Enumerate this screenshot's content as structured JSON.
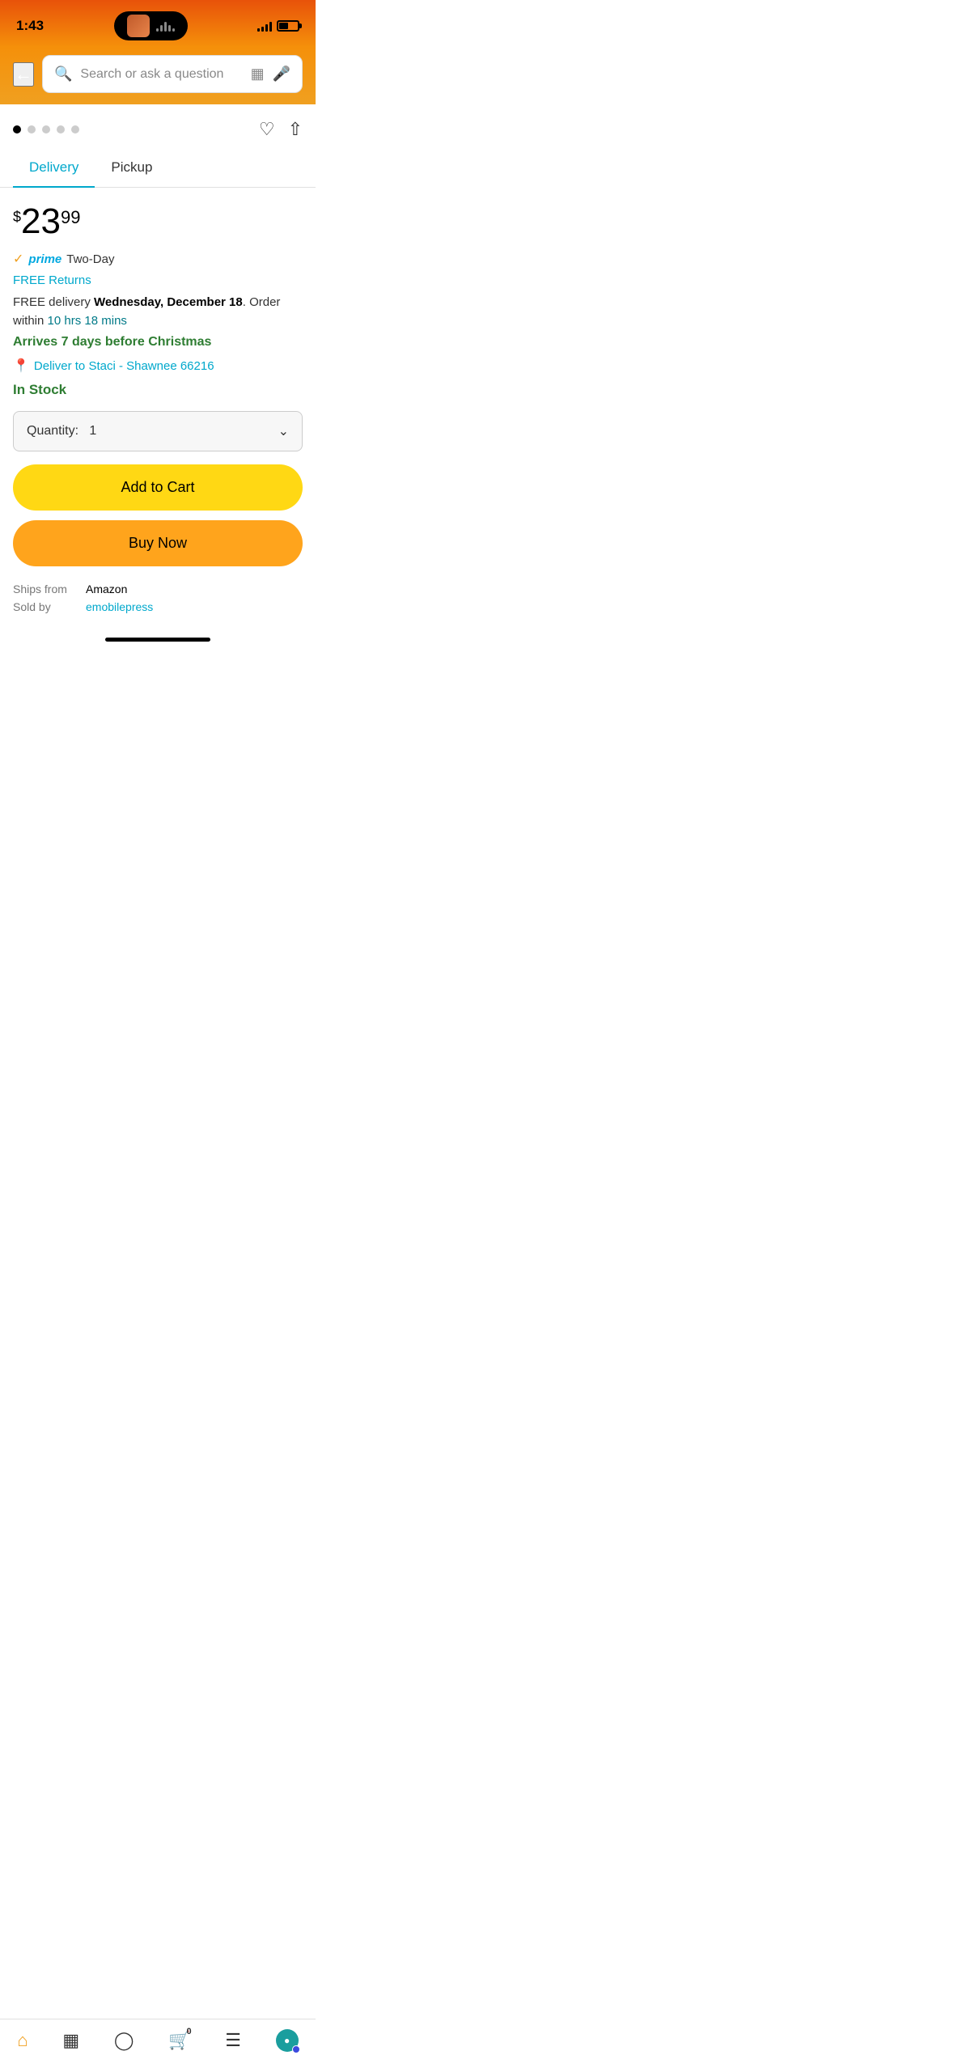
{
  "status": {
    "time": "1:43",
    "battery_pct": 50
  },
  "header": {
    "search_placeholder": "Search or ask a question"
  },
  "carousel": {
    "total_dots": 5,
    "active_dot": 0
  },
  "tabs": {
    "delivery_label": "Delivery",
    "pickup_label": "Pickup",
    "active": "delivery"
  },
  "product": {
    "price_dollar": "$",
    "price_main": "23",
    "price_cents": "99",
    "prime_label": "prime",
    "prime_delivery": "Two-Day",
    "free_returns": "FREE Returns",
    "delivery_text_before": "FREE delivery ",
    "delivery_date": "Wednesday, December 18",
    "delivery_text_after": ". Order within ",
    "delivery_countdown": "10 hrs 18 mins",
    "christmas_message": "Arrives 7 days before Christmas",
    "deliver_to": "Deliver to Staci - Shawnee 66216",
    "stock_status": "In Stock",
    "quantity_label": "Quantity:",
    "quantity_value": "1",
    "add_to_cart": "Add to Cart",
    "buy_now": "Buy Now",
    "ships_from_label": "Ships from",
    "ships_from_value": "Amazon",
    "sold_by_label": "Sold by",
    "sold_by_value": "emobilepress"
  },
  "bottom_nav": {
    "home_label": "home",
    "media_label": "media",
    "account_label": "account",
    "cart_label": "cart",
    "cart_count": "0",
    "menu_label": "menu",
    "alexa_label": "alexa"
  }
}
